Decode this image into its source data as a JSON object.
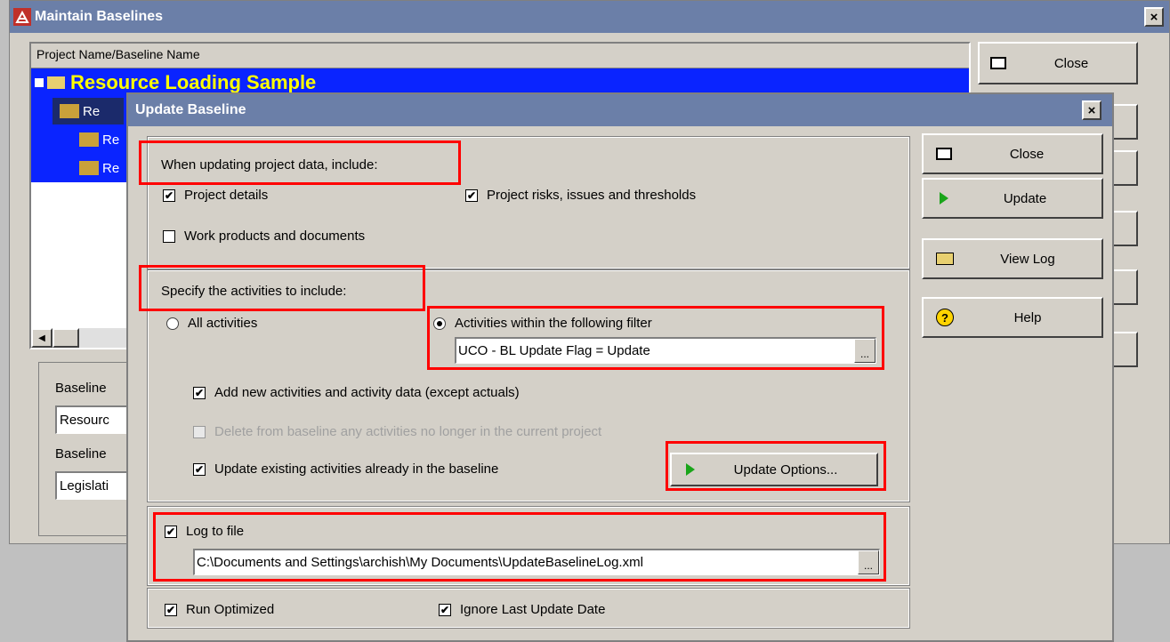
{
  "outer": {
    "title": "Maintain Baselines",
    "column_header": "Project Name/Baseline Name",
    "tree": {
      "project": "Resource Loading Sample",
      "rows": [
        "Re",
        "Re",
        "Re"
      ]
    },
    "close_label": "Close",
    "fields": [
      {
        "label": "Baseline",
        "value": "Resourc"
      },
      {
        "label": "Baseline",
        "value": "Legislati"
      }
    ]
  },
  "dialog": {
    "title": "Update Baseline",
    "section1": {
      "heading": "When updating project data, include:",
      "project_details": "Project details",
      "project_risks": "Project risks, issues and thresholds",
      "work_products": "Work products and documents"
    },
    "section2": {
      "heading": "Specify the activities to include:",
      "all_activities": "All activities",
      "filter_option": "Activities within the following filter",
      "filter_value": "UCO - BL Update Flag = Update",
      "add_new": "Add new activities and activity data (except actuals)",
      "delete_from": "Delete from baseline any activities no longer in the current project",
      "update_existing": "Update existing activities already in the baseline",
      "update_options": "Update Options..."
    },
    "section3": {
      "log_to_file": "Log to file",
      "log_path": "C:\\Documents and Settings\\archish\\My Documents\\UpdateBaselineLog.xml"
    },
    "section4": {
      "run_optimized": "Run Optimized",
      "ignore_last": "Ignore Last Update Date"
    },
    "buttons": {
      "close": "Close",
      "update": "Update",
      "view_log": "View Log",
      "help": "Help"
    },
    "ellipsis": "..."
  },
  "glyphs": {
    "close_x": "×",
    "check": "✔",
    "help": "?"
  },
  "colors": {
    "title_bar": "#6b7fa8",
    "selection": "#0a24ff",
    "project_text": "#ffff00",
    "highlight": "#ff0000"
  }
}
